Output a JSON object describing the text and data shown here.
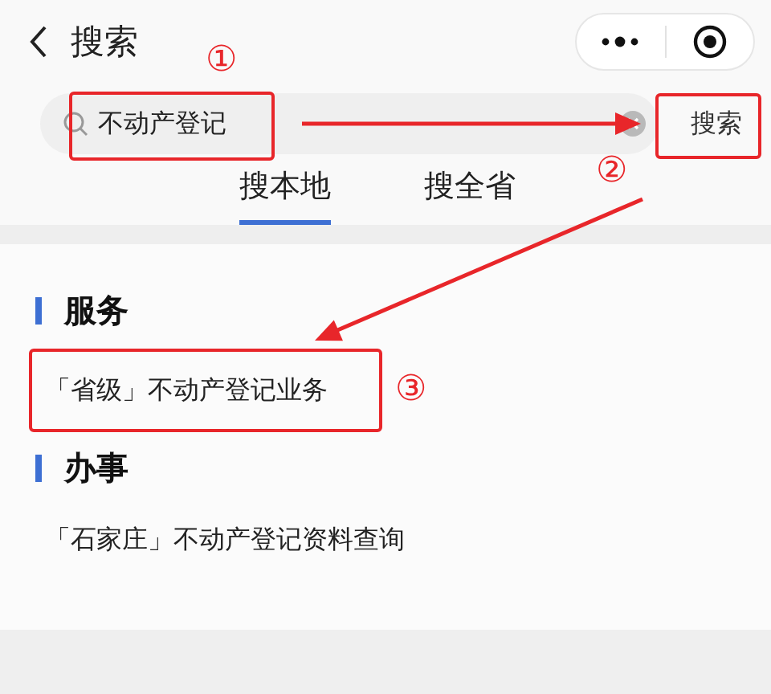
{
  "header": {
    "title": "搜索"
  },
  "search": {
    "value": "不动产登记",
    "button": "搜索"
  },
  "tabs": [
    {
      "label": "搜本地",
      "selected": true
    },
    {
      "label": "搜全省",
      "selected": false
    }
  ],
  "sections": [
    {
      "title": "服务",
      "items": [
        "「省级」不动产登记业务"
      ]
    },
    {
      "title": "办事",
      "items": [
        "「石家庄」不动产登记资料查询"
      ]
    }
  ],
  "annotations": [
    {
      "label": "①"
    },
    {
      "label": "②"
    },
    {
      "label": "③"
    }
  ]
}
